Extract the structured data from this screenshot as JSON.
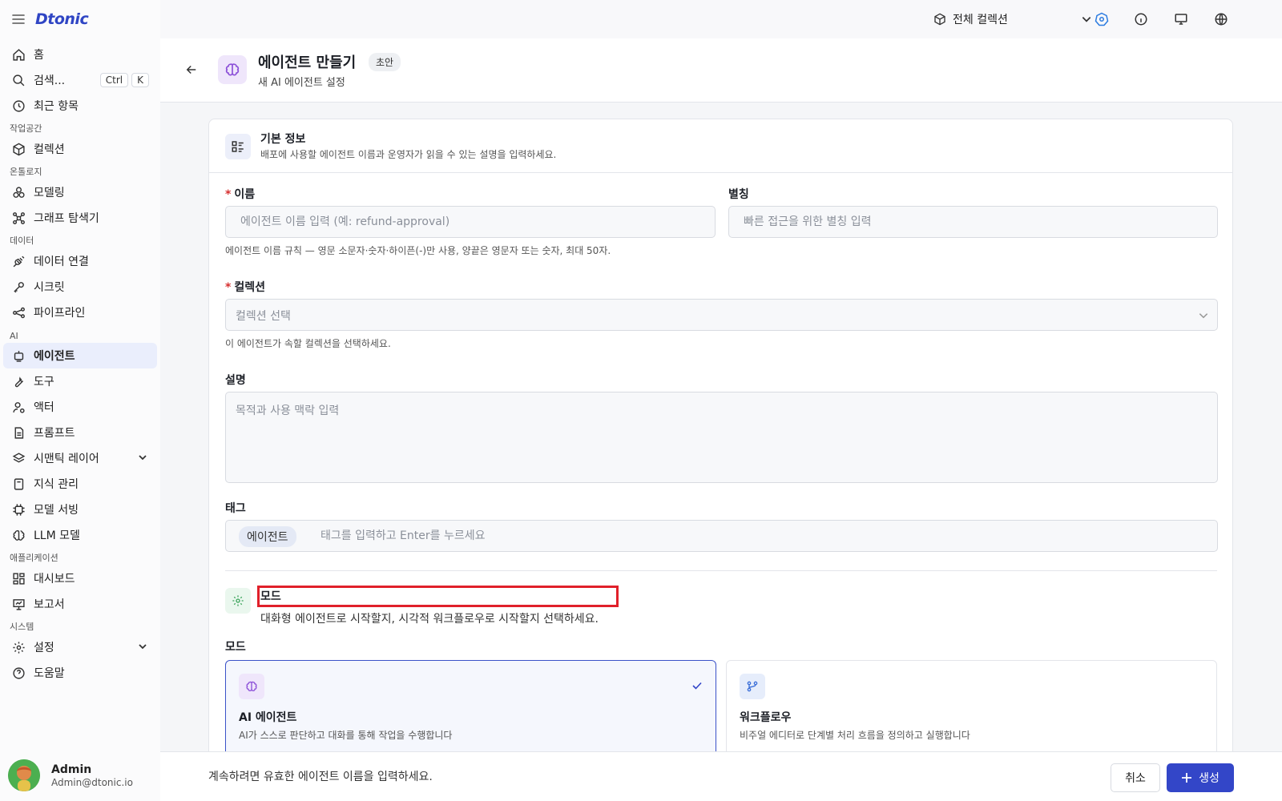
{
  "app": {
    "logo": "Dtonic"
  },
  "topbar": {
    "collection_select": "전체 컬렉션"
  },
  "sidebar": {
    "home": "홈",
    "search": "검색...",
    "search_kbd": [
      "Ctrl",
      "K"
    ],
    "recent": "최근 항목",
    "sections": {
      "workspace": "작업공간",
      "ontology": "온톨로지",
      "data": "데이터",
      "ai": "AI",
      "applications": "애플리케이션",
      "system": "시스템"
    },
    "items": {
      "collection": "컬렉션",
      "modeling": "모델링",
      "graph_explorer": "그래프 탐색기",
      "data_connection": "데이터 연결",
      "secret": "시크릿",
      "pipeline": "파이프라인",
      "agent": "에이전트",
      "tool": "도구",
      "actor": "액터",
      "prompt": "프롬프트",
      "semantic_layer": "시맨틱 레이어",
      "knowledge": "지식 관리",
      "model_serving": "모델 서빙",
      "llm_model": "LLM 모델",
      "dashboard": "대시보드",
      "report": "보고서",
      "settings": "설정",
      "help": "도움말"
    },
    "active_item": "agent",
    "user": {
      "name": "Admin",
      "email": "Admin@dtonic.io"
    }
  },
  "header": {
    "title": "에이전트 만들기",
    "badge": "초안",
    "subtitle": "새 AI 에이전트 설정"
  },
  "card": {
    "title": "기본 정보",
    "desc": "배포에 사용할 에이전트 이름과 운영자가 읽을 수 있는 설명을 입력하세요.",
    "name_label": "이름",
    "name_placeholder": "에이전트 이름 입력 (예: refund-approval)",
    "name_help": "에이전트 이름 규칙 — 영문 소문자·숫자·하이픈(-)만 사용, 양끝은 영문자 또는 숫자, 최대 50자.",
    "alias_label": "별칭",
    "alias_placeholder": "빠른 접근을 위한 별칭 입력",
    "collection_label": "컬렉션",
    "collection_placeholder": "컬렉션 선택",
    "collection_help": "이 에이전트가 속할 컬렉션을 선택하세요.",
    "desc_label": "설명",
    "desc_placeholder": "목적과 사용 맥락 입력",
    "tag_label": "태그",
    "tags": [
      "에이전트"
    ],
    "tag_placeholder": "태그를 입력하고 Enter를 누르세요",
    "mode_section_title": "모드",
    "mode_section_desc": "대화형 에이전트로 시작할지, 시각적 워크플로우로 시작할지 선택하세요.",
    "mode_label": "모드",
    "mode_options": [
      {
        "title": "AI 에이전트",
        "desc": "AI가 스스로 판단하고 대화를 통해 작업을 수행합니다",
        "selected": true
      },
      {
        "title": "워크플로우",
        "desc": "비주얼 에디터로 단계별 처리 흐름을 정의하고 실행합니다",
        "selected": false
      }
    ]
  },
  "footer": {
    "message": "계속하려면 유효한 에이전트 이름을 입력하세요.",
    "cancel": "취소",
    "create": "생성"
  },
  "colors": {
    "accent": "#3346c8",
    "highlight": "#e0202a",
    "active_nav_bg": "#eaeefc"
  }
}
